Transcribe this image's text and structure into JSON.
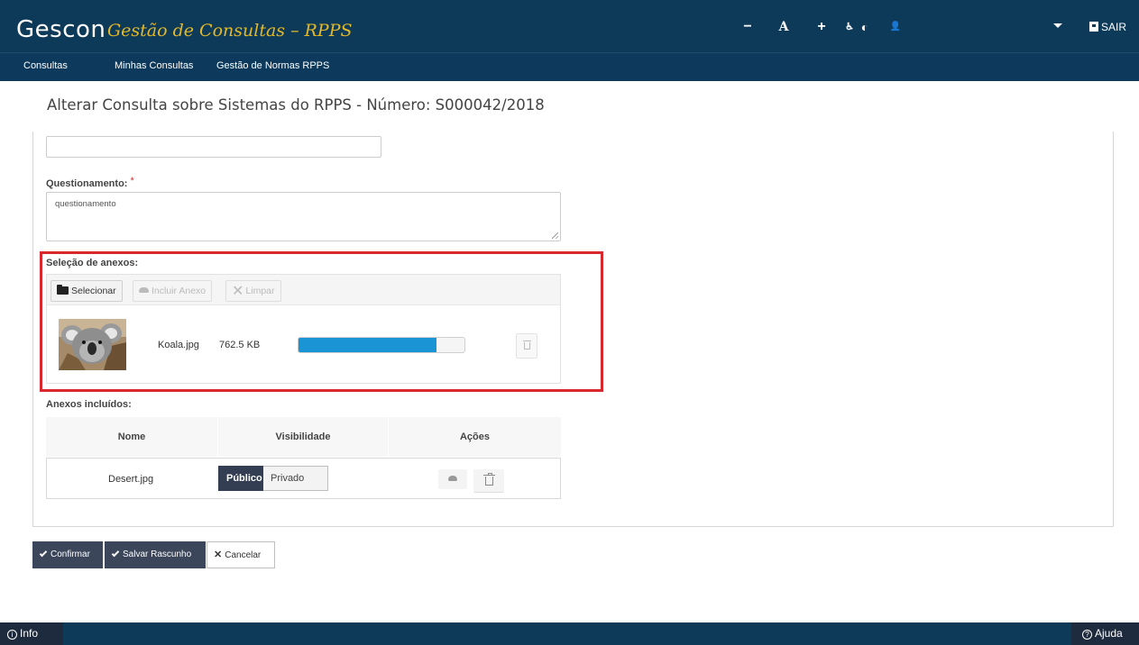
{
  "header": {
    "brand": "Gescon",
    "brand_subtitle": "Gestão de Consultas – RPPS",
    "accessibility": {
      "contrast": "◐",
      "decrease": "−",
      "font": "A",
      "increase": "+",
      "a11y": "♿︎",
      "user": "👤"
    },
    "logout_label": "SAIR"
  },
  "nav": {
    "items": [
      "Consultas",
      "Minhas Consultas",
      "Gestão de Normas RPPS"
    ]
  },
  "page": {
    "title": "Alterar Consulta sobre Sistemas do RPPS - Número: S000042/2018"
  },
  "form": {
    "top_input_value": "",
    "question_label": "Questionamento:",
    "required_mark": "*",
    "question_value": "questionamento",
    "attachments_label": "Seleção de anexos:",
    "select_button": "Selecionar",
    "include_button": "Incluir Anexo",
    "clear_button": "Limpar",
    "pending_file": {
      "name": "Koala.jpg",
      "size": "762.5 KB",
      "progress_percent": 83
    },
    "included_label": "Anexos incluídos:",
    "table": {
      "headers": [
        "Nome",
        "Visibilidade",
        "Ações"
      ],
      "rows": [
        {
          "name": "Desert.jpg",
          "public_label": "Público",
          "private_label": "Privado",
          "selected": "Público"
        }
      ]
    }
  },
  "actions": {
    "confirm": "Confirmar",
    "save_draft": "Salvar Rascunho",
    "cancel": "Cancelar"
  },
  "footer": {
    "info": "Info",
    "help": "Ajuda"
  },
  "colors": {
    "header_bg": "#0e3a5a",
    "brand_subtitle": "#e3b928",
    "highlight": "#d9272e",
    "progress": "#1a94d4",
    "dark_button": "#3b465a"
  }
}
